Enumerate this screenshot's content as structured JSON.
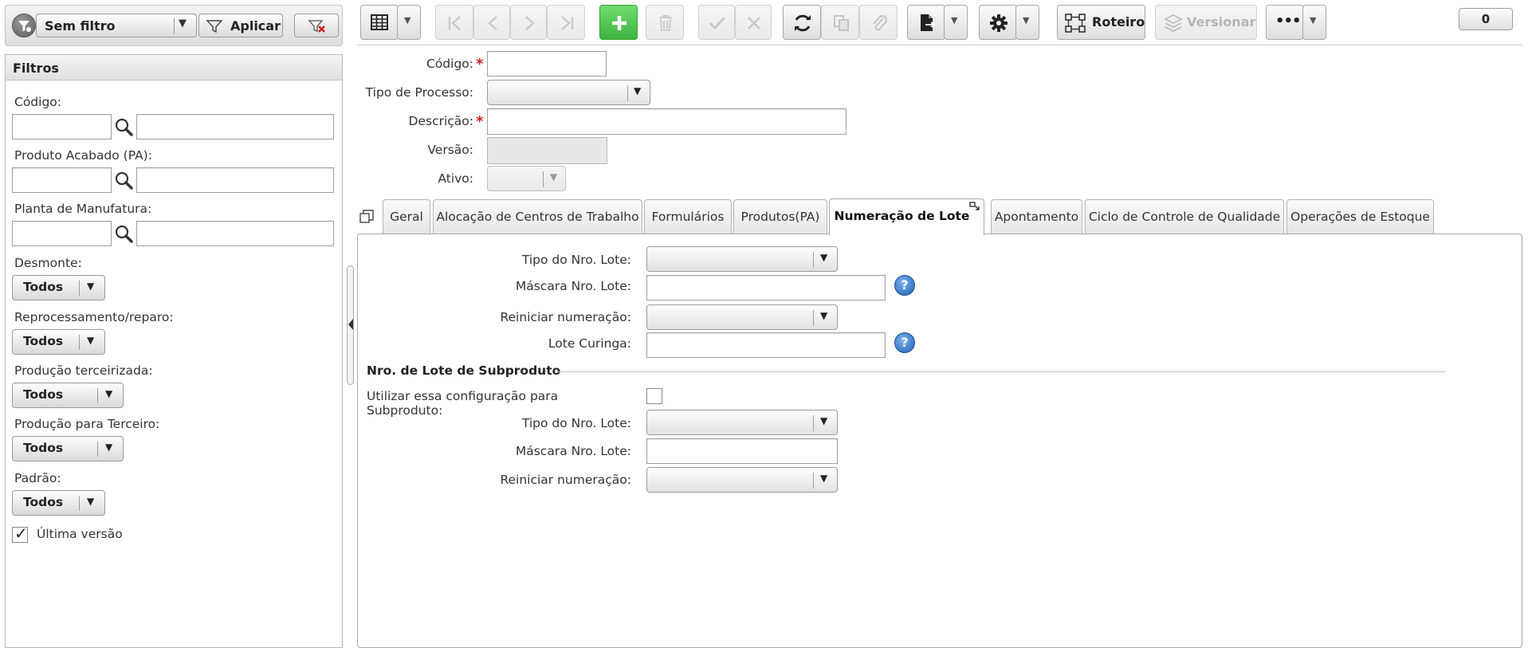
{
  "filterbar": {
    "saved_filter": "Sem filtro",
    "apply_label": "Aplicar"
  },
  "filters": {
    "title": "Filtros",
    "codigo_label": "Código:",
    "produto_label": "Produto Acabado (PA):",
    "planta_label": "Planta de Manufatura:",
    "desmonte_label": "Desmonte:",
    "desmonte_value": "Todos",
    "reprocessamento_label": "Reprocessamento/reparo:",
    "reprocessamento_value": "Todos",
    "prod_terceirizada_label": "Produção terceirizada:",
    "prod_terceirizada_value": "Todos",
    "prod_terceiro_label": "Produção para Terceiro:",
    "prod_terceiro_value": "Todos",
    "padrao_label": "Padrão:",
    "padrao_value": "Todos",
    "ultima_versao_label": "Última versão",
    "ultima_versao_checked": true
  },
  "toolbar": {
    "roteiro_label": "Roteiro",
    "versionar_label": "Versionar",
    "more_label": "•••",
    "counter": "0"
  },
  "form": {
    "codigo_label": "Código:",
    "codigo_value": "",
    "tipo_processo_label": "Tipo de Processo:",
    "tipo_processo_value": "",
    "descricao_label": "Descrição:",
    "descricao_value": "",
    "versao_label": "Versão:",
    "versao_value": "",
    "ativo_label": "Ativo:",
    "ativo_value": "",
    "required_mark": "*"
  },
  "tabs": [
    {
      "label": "Geral"
    },
    {
      "label": "Alocação de Centros de Trabalho"
    },
    {
      "label": "Formulários"
    },
    {
      "label": "Produtos(PA)"
    },
    {
      "label": "Numeração de Lote",
      "active": true
    },
    {
      "label": "Apontamento"
    },
    {
      "label": "Ciclo de Controle de Qualidade"
    },
    {
      "label": "Operações de Estoque"
    }
  ],
  "lote": {
    "tipo_label": "Tipo do Nro. Lote:",
    "mascara_label": "Máscara Nro. Lote:",
    "reiniciar_label": "Reiniciar numeração:",
    "curinga_label": "Lote Curinga:",
    "help_glyph": "?",
    "sub_section_title": "Nro. de Lote de Subproduto",
    "utilizar_label": "Utilizar essa configuração para Subproduto:",
    "utilizar_checked": false,
    "sub_tipo_label": "Tipo do Nro. Lote:",
    "sub_mascara_label": "Máscara Nro. Lote:",
    "sub_reiniciar_label": "Reiniciar numeração:"
  },
  "colors": {
    "accent_green": "#4cc24c",
    "help_blue": "#2a6fc4",
    "required_red": "#cc2222"
  }
}
